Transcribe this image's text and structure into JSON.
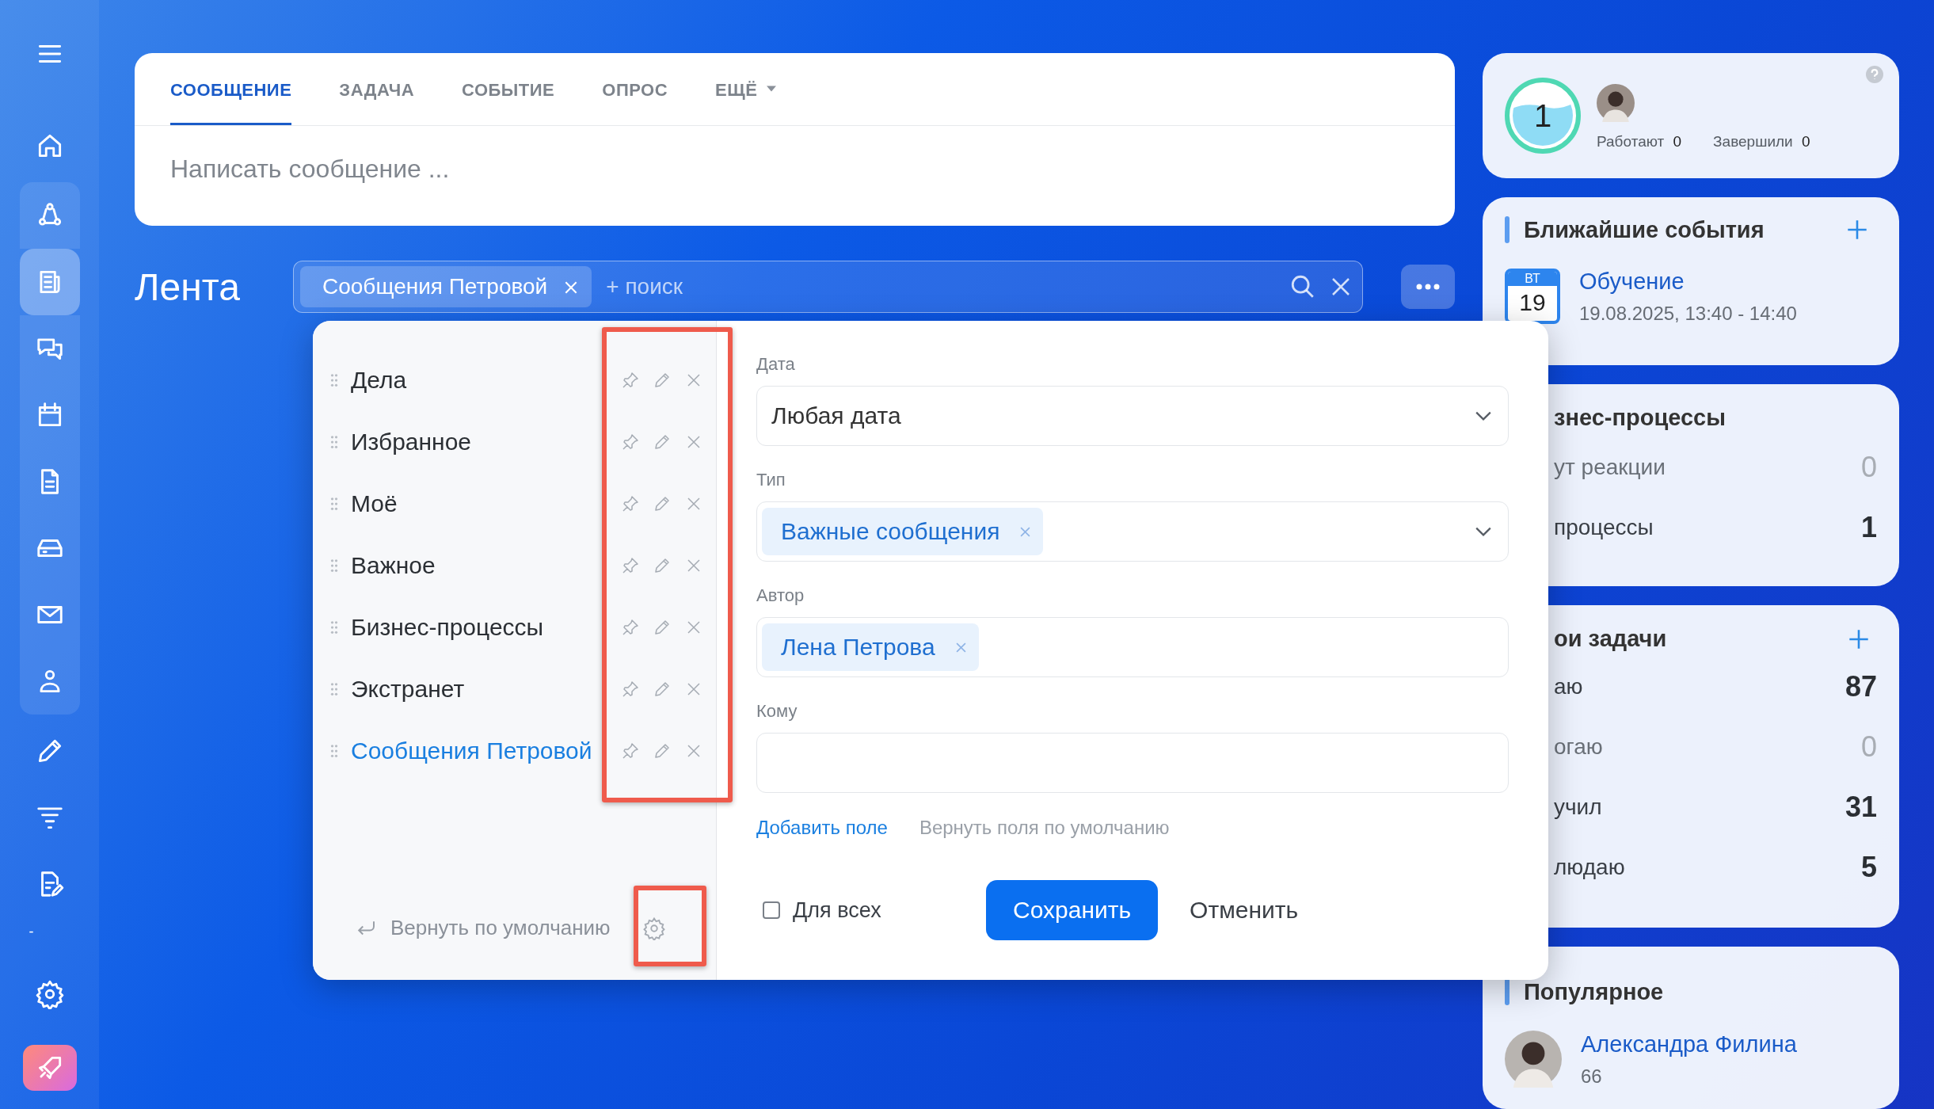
{
  "sidebar": {
    "items": [
      {
        "selected": false
      },
      {
        "selected": false
      },
      {
        "selected": false
      },
      {
        "selected": true
      },
      {
        "selected": false
      },
      {
        "selected": false
      },
      {
        "selected": false
      },
      {
        "selected": false
      },
      {
        "selected": false
      },
      {
        "selected": false
      },
      {
        "selected": false
      },
      {
        "selected": false
      },
      {
        "selected": false
      },
      {
        "selected": false
      },
      {
        "selected": false
      }
    ],
    "separator_text": "-"
  },
  "composer": {
    "tabs": [
      {
        "label": "СООБЩЕНИЕ",
        "selected": true,
        "kind": "tab"
      },
      {
        "label": "ЗАДАЧА",
        "selected": false,
        "kind": "tab"
      },
      {
        "label": "СОБЫТИЕ",
        "selected": false,
        "kind": "tab"
      },
      {
        "label": "ОПРОС",
        "selected": false,
        "kind": "tab"
      },
      {
        "label": "ЕЩЁ",
        "selected": false,
        "kind": "dropdown"
      }
    ],
    "placeholder": "Написать сообщение ..."
  },
  "feed": {
    "title": "Лента",
    "filter_chip": "Сообщения Петровой",
    "search_placeholder": "+ поиск"
  },
  "filter_popup": {
    "presets": [
      {
        "label": "Дела",
        "selected": false
      },
      {
        "label": "Избранное",
        "selected": false
      },
      {
        "label": "Моё",
        "selected": false
      },
      {
        "label": "Важное",
        "selected": false
      },
      {
        "label": "Бизнес-процессы",
        "selected": false
      },
      {
        "label": "Экстранет",
        "selected": false
      },
      {
        "label": "Сообщения Петровой",
        "selected": true
      }
    ],
    "reset": "Вернуть по умолчанию",
    "fields": [
      {
        "label": "Дата",
        "kind": "select",
        "value": "Любая дата"
      },
      {
        "label": "Тип",
        "kind": "tag_select",
        "tags": [
          "Важные сообщения"
        ]
      },
      {
        "label": "Автор",
        "kind": "tags",
        "tags": [
          "Лена Петрова"
        ]
      },
      {
        "label": "Кому",
        "kind": "input"
      }
    ],
    "add_field": "Добавить поле",
    "reset_fields": "Вернуть поля по умолчанию",
    "for_all": {
      "label": "Для всех",
      "checked": false
    },
    "save": "Сохранить",
    "cancel": "Отменить"
  },
  "work_day": {
    "counter": "1",
    "stats": [
      {
        "label": "Работают",
        "value": "0"
      },
      {
        "label": "Завершили",
        "value": "0"
      }
    ]
  },
  "events": {
    "title": "Ближайшие события",
    "event": {
      "weekday": "ВТ",
      "day": "19",
      "title": "Обучение",
      "time": "19.08.2025, 13:40 - 14:40"
    }
  },
  "processes": {
    "title": "знес-процессы",
    "rows": [
      {
        "label": "ут реакции",
        "value": "0",
        "muted": true
      },
      {
        "label": "процессы",
        "value": "1",
        "muted": false
      }
    ]
  },
  "tasks": {
    "title": "ои задачи",
    "rows": [
      {
        "label": "аю",
        "value": "87",
        "muted": false
      },
      {
        "label": "огаю",
        "value": "0",
        "muted": true
      },
      {
        "label": "учил",
        "value": "31",
        "muted": false
      },
      {
        "label": "людаю",
        "value": "5",
        "muted": false
      }
    ]
  },
  "popular": {
    "title": "Популярное",
    "person": {
      "name": "Александра Филина",
      "count": "66"
    }
  }
}
